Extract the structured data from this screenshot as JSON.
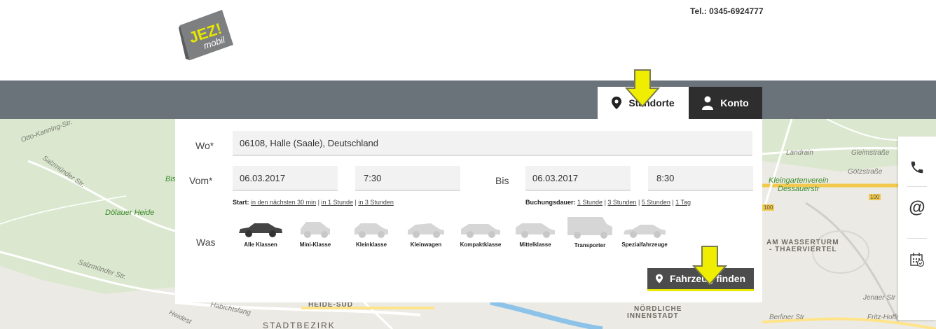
{
  "brand": {
    "logo_text": "JEZ!",
    "logo_sub": "mobil",
    "logo_color": "#7d7f80",
    "logo_accent": "#e7e600"
  },
  "header": {
    "phone": "Tel.: 0345-6924777"
  },
  "tabs": [
    {
      "label": "Standorte",
      "icon": "location-pin-icon",
      "active": true
    },
    {
      "label": "Konto",
      "icon": "user-icon",
      "active": false
    }
  ],
  "form": {
    "wo_label": "Wo*",
    "wo_value": "06108, Halle (Saale), Deutschland",
    "vom_label": "Vom*",
    "vom_date": "06.03.2017",
    "vom_time": "7:30",
    "bis_label": "Bis",
    "bis_date": "06.03.2017",
    "bis_time": "8:30",
    "start_label": "Start:",
    "start_options": [
      "in den nächsten 30 min",
      "in 1 Stunde",
      "in 3 Stunden"
    ],
    "dauer_label": "Buchungsdauer:",
    "dauer_options": [
      "1 Stunde",
      "3 Stunden",
      "5 Stunden",
      "1 Tag"
    ],
    "was_label": "Was",
    "car_classes": [
      "Alle Klassen",
      "Mini-Klasse",
      "Kleinklasse",
      "Kleinwagen",
      "Kompaktklasse",
      "Mittelklasse",
      "Transporter",
      "Spezialfahrzeuge"
    ],
    "selected_class": "Alle Klassen",
    "find_button": "Fahrzeug finden"
  },
  "map": {
    "labels": {
      "otto": "Otto-Kanning-Str.",
      "salzmuender1": "Salzmünder Str.",
      "salzmuender2": "Salzmünder Str.",
      "bis": "Bis",
      "doelauer": "Dölauer Heide",
      "heide_sued": "HEIDE-SÜD",
      "stadtbezirk": "STADTBEZIRK",
      "habichtsfang": "Habichtsfang",
      "heideste": "Heidest",
      "nordliche1": "NÖRDLICHE",
      "nordliche2": "INNENSTADT",
      "landrain": "Landrain",
      "gleimstrasse": "Gleimstraße",
      "goetzstrasse": "Götzstraße",
      "kleingarten1": "Kleingartenverein",
      "kleingarten2": "Dessauerstr",
      "wasserturm1": "AM WASSERTURM",
      "wasserturm2": "- THAERVIERTEL",
      "jenaer": "Jenaer Str",
      "berliner": "Berliner Str",
      "fritz": "Fritz-Hoffmann-S",
      "road100a": "100",
      "road100b": "100"
    }
  },
  "sidebar": {
    "icons": [
      "phone-icon",
      "email-at-icon",
      "calendar-check-icon"
    ]
  },
  "colors": {
    "navbar": "#6b737a",
    "accent_yellow": "#e7e600",
    "dark": "#2e2e2e",
    "map": "#eceae4"
  }
}
